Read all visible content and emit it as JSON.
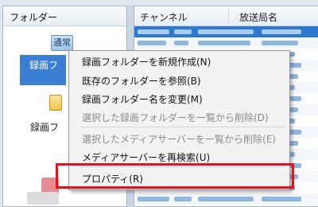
{
  "folder_panel": {
    "header": "フォルダー",
    "tag_label": "通常",
    "tree_items": [
      "録画フ",
      "録画フ"
    ]
  },
  "channel_panel": {
    "columns": [
      "チャンネル",
      "放送局名"
    ]
  },
  "context_menu": {
    "items": [
      {
        "label": "録画フォルダーを新規作成(N)",
        "enabled": true
      },
      {
        "label": "既存のフォルダーを参照(B)",
        "enabled": true
      },
      {
        "label": "録画フォルダー名を変更(M)",
        "enabled": true
      },
      {
        "label": "選択した録画フォルダーを一覧から削除(D)",
        "enabled": false
      },
      {
        "label": "選択したメディアサーバーを一覧から削除(E)",
        "enabled": false
      },
      {
        "label": "メディアサーバーを再検索(U)",
        "enabled": true
      },
      {
        "label": "プロパティ(R)",
        "enabled": true
      }
    ]
  },
  "colors": {
    "selection": "#3a7fd3",
    "highlight_border": "#e8101e"
  }
}
